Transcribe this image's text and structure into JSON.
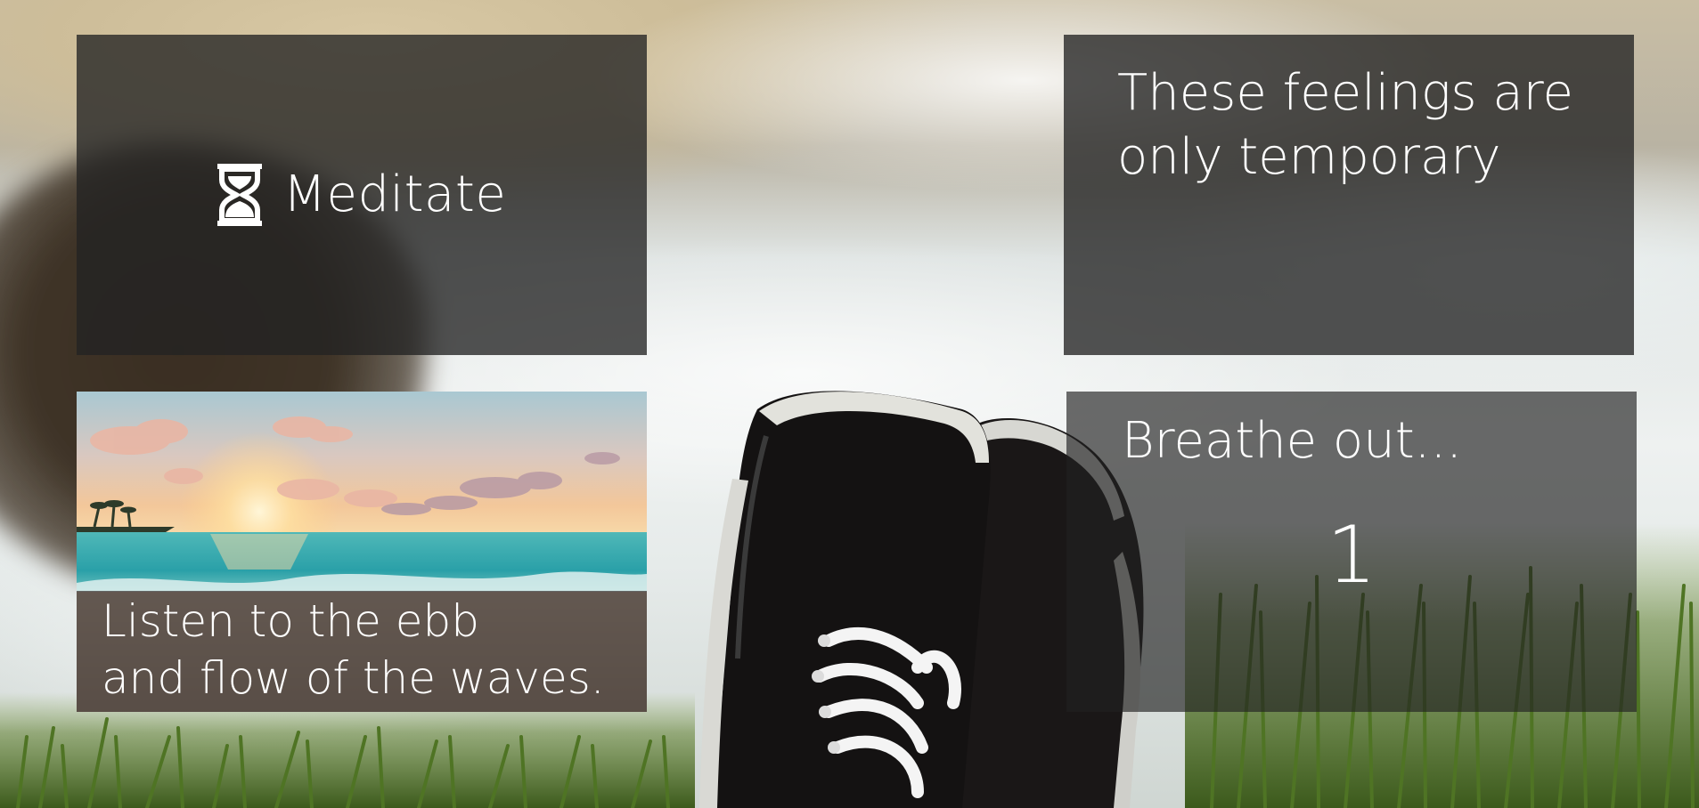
{
  "background": {
    "icon": "beach-grass-sneakers-photo"
  },
  "meditate": {
    "label": "Meditate",
    "icon": "hourglass-icon"
  },
  "feelings": {
    "text": "These feelings are only temporary"
  },
  "waves": {
    "image": "sunset-beach-photo",
    "line1": "Listen to the ebb",
    "line2": "and flow of the waves."
  },
  "breathe": {
    "title": "Breathe out...",
    "count": "1"
  },
  "colors": {
    "panel": "#222222",
    "text": "#ffffff"
  }
}
